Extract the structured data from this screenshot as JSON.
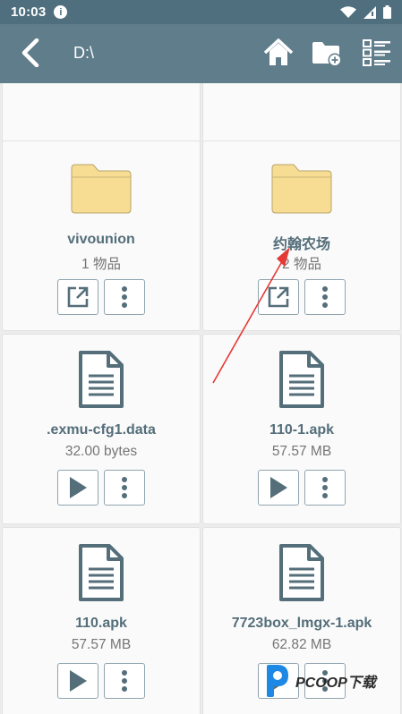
{
  "status": {
    "time": "10:03",
    "info_glyph": "i"
  },
  "toolbar": {
    "path": "D:\\",
    "back_icon": "back-arrow-icon",
    "home_icon": "home-icon",
    "new_folder_icon": "new-folder-icon",
    "view_icon": "list-view-icon"
  },
  "items": [
    {
      "type": "partial",
      "primary_icon": "open-external-icon"
    },
    {
      "type": "partial",
      "primary_icon": "open-external-icon"
    },
    {
      "type": "folder",
      "name": "vivounion",
      "meta": "1 物品"
    },
    {
      "type": "folder",
      "name": "约翰农场",
      "meta": "2 物品"
    },
    {
      "type": "file",
      "name": ".exmu-cfg1.data",
      "meta": "32.00 bytes"
    },
    {
      "type": "file",
      "name": "110-1.apk",
      "meta": "57.57 MB"
    },
    {
      "type": "file",
      "name": "110.apk",
      "meta": "57.57 MB"
    },
    {
      "type": "file",
      "name": "7723box_lmgx-1.apk",
      "meta": "62.82 MB"
    }
  ],
  "watermark": {
    "text": "PCOOP下载"
  },
  "colors": {
    "appbar": "#607d8b",
    "statusbar": "#4f6f7e",
    "folder": "#f7dd93",
    "icon": "#546e7a",
    "annotation": "#e53935"
  }
}
